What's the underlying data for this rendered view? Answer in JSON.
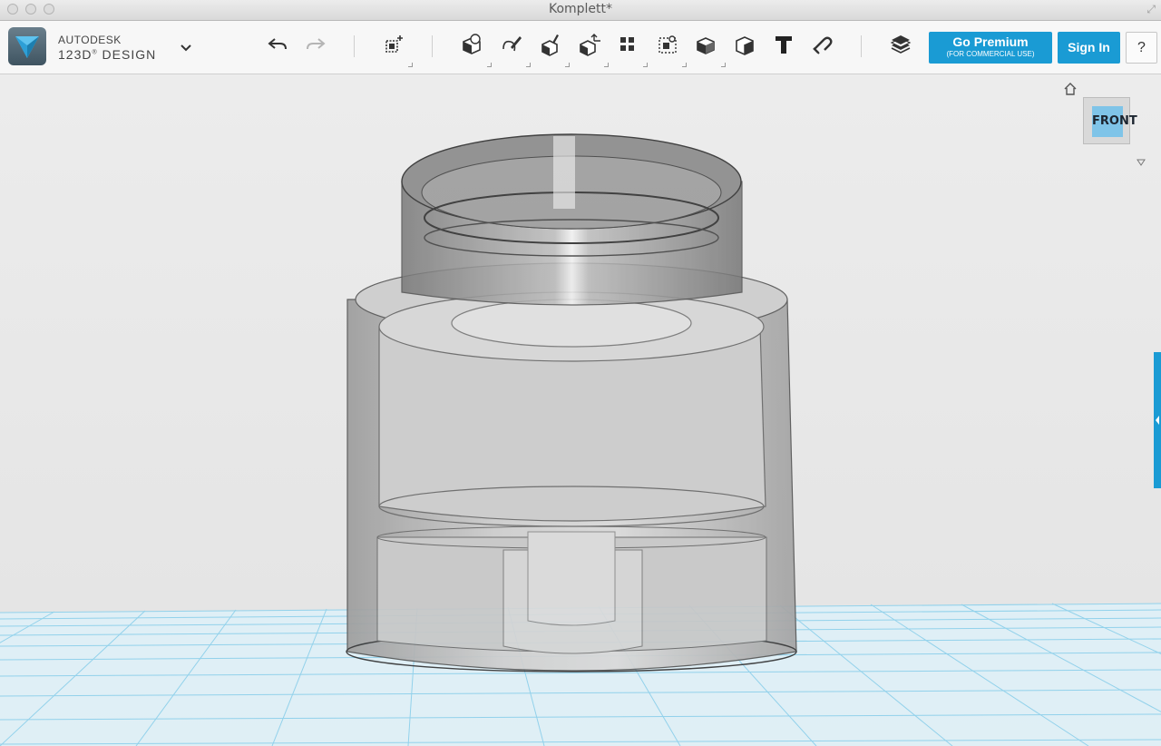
{
  "window": {
    "title": "Komplett*"
  },
  "brand": {
    "company": "AUTODESK",
    "product": "123D",
    "product_suffix": "DESIGN"
  },
  "toolbar": {
    "tools": [
      "undo-icon",
      "redo-icon",
      "smart-primitive-icon",
      "primitives-icon",
      "sketch-icon",
      "construct-icon",
      "transform-icon",
      "pattern-icon",
      "group-icon",
      "combine-icon",
      "modify-icon",
      "measure-icon",
      "text-icon",
      "snap-icon",
      "materials-icon"
    ]
  },
  "buttons": {
    "premium_label": "Go Premium",
    "premium_sub": "(FOR COMMERCIAL USE)",
    "signin_label": "Sign In",
    "help_label": "?"
  },
  "viewcube": {
    "face_label": "FRONT"
  },
  "colors": {
    "accent": "#1a9bd4",
    "grid": "#8ad0ec"
  }
}
